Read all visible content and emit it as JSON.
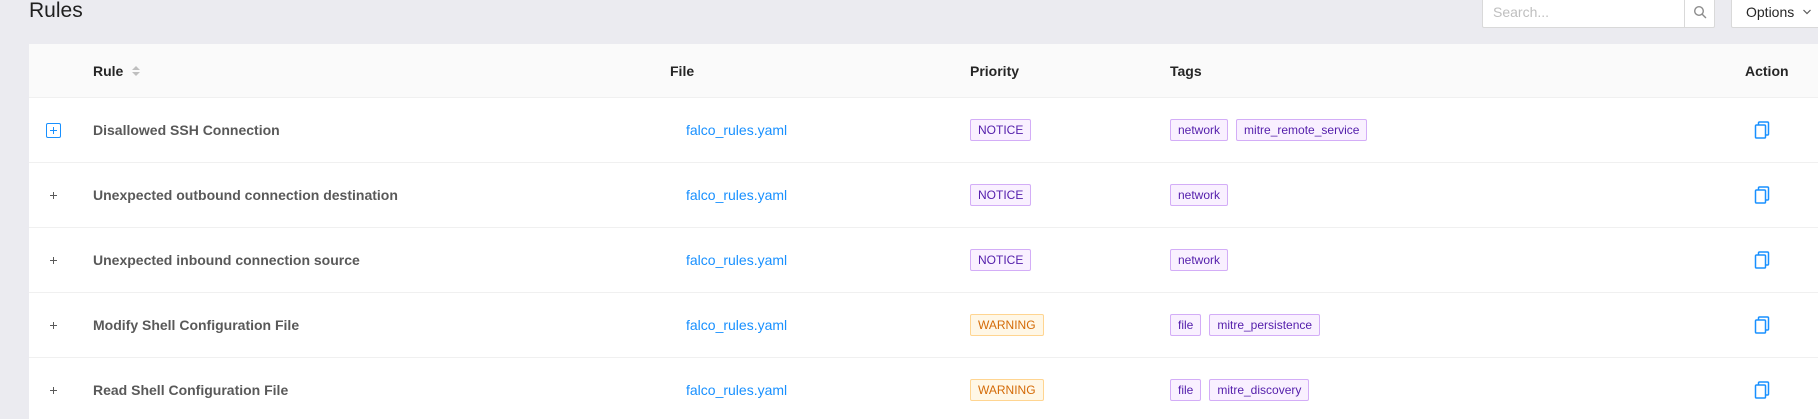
{
  "page": {
    "title": "Rules"
  },
  "search": {
    "placeholder": "Search...",
    "value": ""
  },
  "options": {
    "label": "Options"
  },
  "table": {
    "columns": {
      "rule": "Rule",
      "file": "File",
      "priority": "Priority",
      "tags": "Tags",
      "action": "Action"
    },
    "rows": [
      {
        "rule": "Disallowed SSH Connection",
        "file": "falco_rules.yaml",
        "priority": "NOTICE",
        "tags": [
          "network",
          "mitre_remote_service"
        ]
      },
      {
        "rule": "Unexpected outbound connection destination",
        "file": "falco_rules.yaml",
        "priority": "NOTICE",
        "tags": [
          "network"
        ]
      },
      {
        "rule": "Unexpected inbound connection source",
        "file": "falco_rules.yaml",
        "priority": "NOTICE",
        "tags": [
          "network"
        ]
      },
      {
        "rule": "Modify Shell Configuration File",
        "file": "falco_rules.yaml",
        "priority": "WARNING",
        "tags": [
          "file",
          "mitre_persistence"
        ]
      },
      {
        "rule": "Read Shell Configuration File",
        "file": "falco_rules.yaml",
        "priority": "WARNING",
        "tags": [
          "file",
          "mitre_discovery"
        ]
      }
    ]
  },
  "icons": {
    "search": "search-icon",
    "options": "chevron-down-icon",
    "expand": "plus-icon",
    "action": "copy-icon"
  },
  "colors": {
    "link": "#1890ff",
    "notice": "#531dab",
    "warning": "#d46b08",
    "tag": "#531dab",
    "background": "#ebebf0"
  }
}
